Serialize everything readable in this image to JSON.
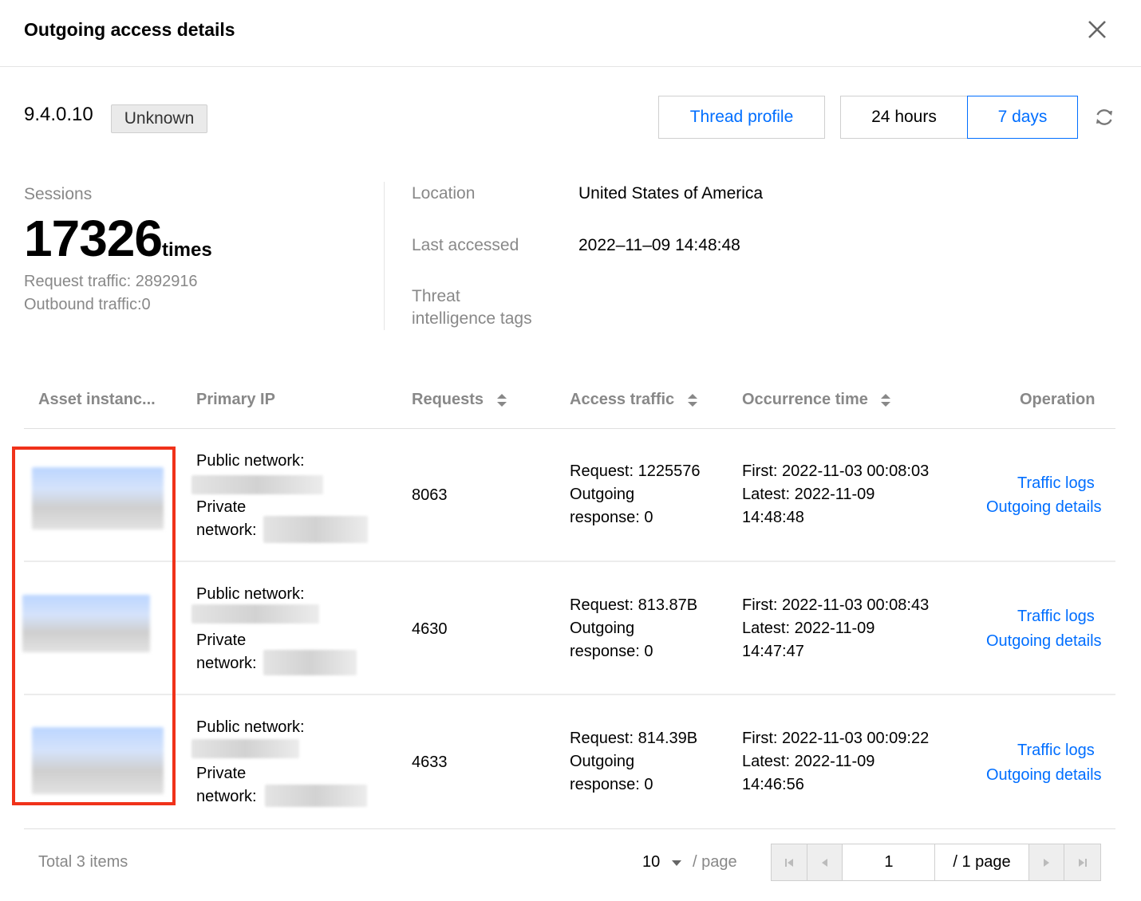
{
  "dialog": {
    "title": "Outgoing access details",
    "close_icon": "close-icon"
  },
  "summary": {
    "ip": "9.4.0.10",
    "badge": "Unknown",
    "thread_profile_label": "Thread profile",
    "range_24h_label": "24 hours",
    "range_7d_label": "7 days",
    "selected_range": "7 days",
    "refresh_icon": "refresh-icon"
  },
  "stats": {
    "sessions_label": "Sessions",
    "sessions_value": "17326",
    "sessions_unit": "times",
    "request_traffic": "Request traffic: 2892916",
    "outbound_traffic": "Outbound traffic:0"
  },
  "info": {
    "location_label": "Location",
    "location_value": "United States of America",
    "last_accessed_label": "Last accessed",
    "last_accessed_value": "2022–11–09 14:48:48",
    "threat_label_line1": "Threat",
    "threat_label_line2": "intelligence tags"
  },
  "table": {
    "columns": {
      "asset": "Asset instanc...",
      "primary_ip": "Primary IP",
      "requests": "Requests",
      "access_traffic": "Access traffic",
      "occurrence_time": "Occurrence time",
      "operation": "Operation"
    },
    "rows": [
      {
        "public_label": "Public network:",
        "private_label_1": "Private",
        "private_label_2": "network:",
        "requests": "8063",
        "traffic_request": "Request: 1225576",
        "traffic_outgoing_1": "Outgoing",
        "traffic_outgoing_2": "response: 0",
        "first": "First: 2022-11-03 00:08:03",
        "latest": "Latest: 2022-11-09",
        "latest_time": "14:48:48",
        "traffic_logs": "Traffic logs",
        "outgoing_details": "Outgoing details"
      },
      {
        "public_label": "Public network:",
        "private_label_1": "Private",
        "private_label_2": "network:",
        "requests": "4630",
        "traffic_request": "Request: 813.87B",
        "traffic_outgoing_1": "Outgoing",
        "traffic_outgoing_2": "response: 0",
        "first": "First: 2022-11-03 00:08:43",
        "latest": "Latest: 2022-11-09",
        "latest_time": "14:47:47",
        "traffic_logs": "Traffic logs",
        "outgoing_details": "Outgoing details"
      },
      {
        "public_label": "Public network:",
        "private_label_1": "Private",
        "private_label_2": "network:",
        "requests": "4633",
        "traffic_request": "Request: 814.39B",
        "traffic_outgoing_1": "Outgoing",
        "traffic_outgoing_2": "response: 0",
        "first": "First: 2022-11-03 00:09:22",
        "latest": "Latest: 2022-11-09",
        "latest_time": "14:46:56",
        "traffic_logs": "Traffic logs",
        "outgoing_details": "Outgoing details"
      }
    ]
  },
  "pagination": {
    "total": "Total 3 items",
    "page_size": "10",
    "page_size_suffix": "/ page",
    "current_page": "1",
    "total_pages": "/ 1 page"
  },
  "colors": {
    "link": "#006eff",
    "highlight": "#f0321a",
    "muted": "#888888"
  }
}
